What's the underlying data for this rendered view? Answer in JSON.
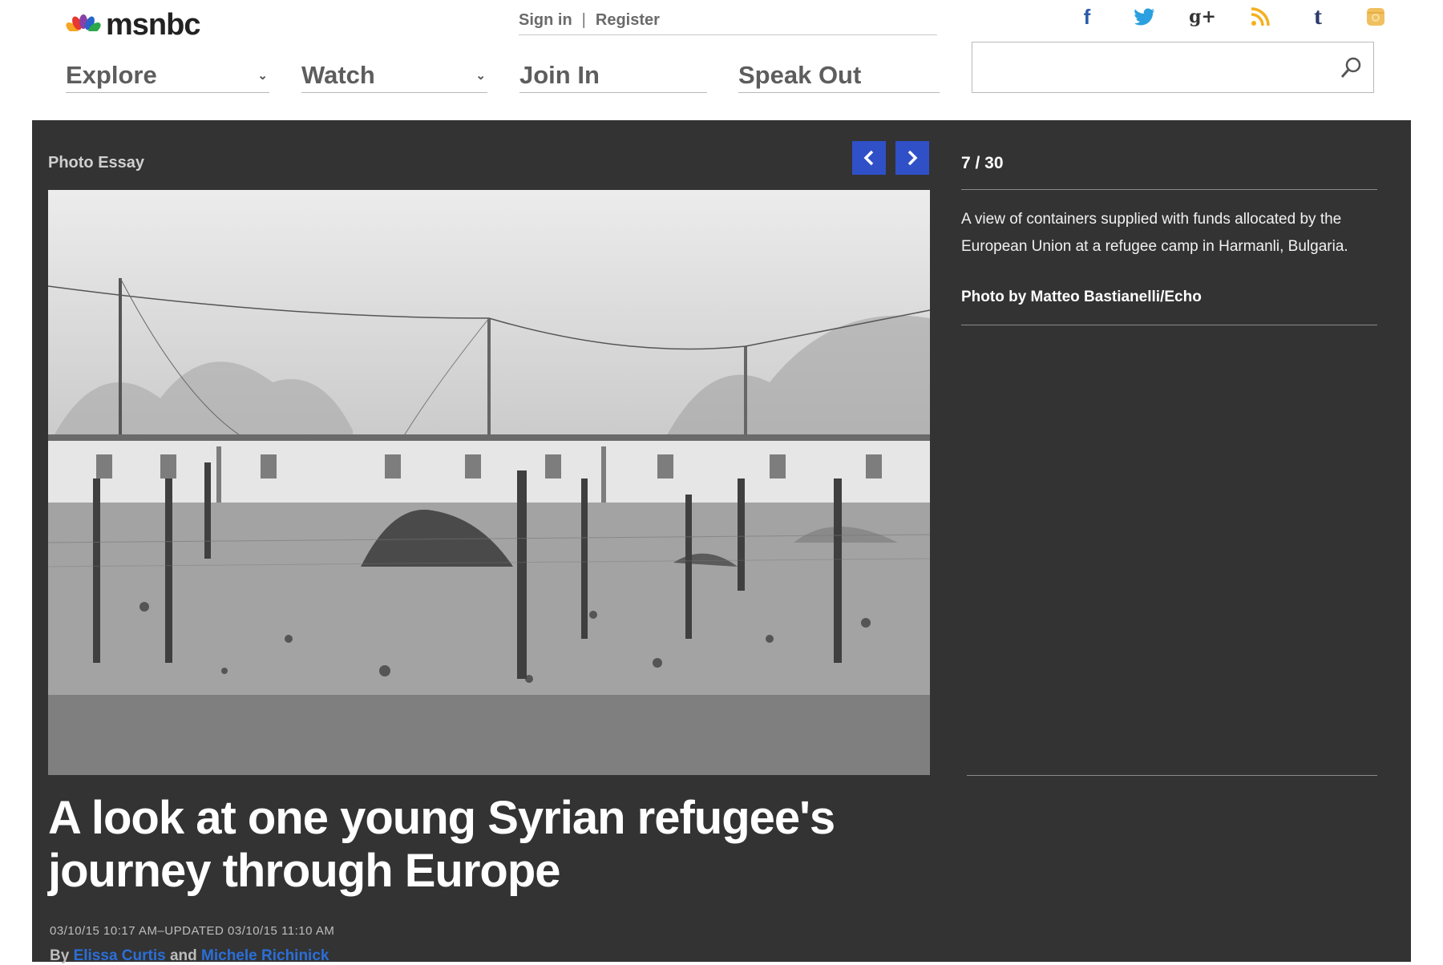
{
  "header": {
    "logo_text": "msnbc",
    "account": {
      "sign_in": "Sign in",
      "separator": "|",
      "register": "Register"
    },
    "social": [
      {
        "icon": "facebook-icon",
        "glyph": "f",
        "color": "#2a5ba8"
      },
      {
        "icon": "twitter-icon",
        "glyph": "🐦",
        "color": "#2aa0e0"
      },
      {
        "icon": "google-plus-icon",
        "glyph": "g+",
        "color": "#333333"
      },
      {
        "icon": "rss-icon",
        "glyph": "rss",
        "color": "#f5b020"
      },
      {
        "icon": "tumblr-icon",
        "glyph": "t",
        "color": "#2a3a6a"
      },
      {
        "icon": "instagram-icon",
        "glyph": "ig",
        "color": "#f0c060"
      }
    ],
    "nav": [
      {
        "label": "Explore",
        "dropdown": true
      },
      {
        "label": "Watch",
        "dropdown": true
      },
      {
        "label": "Join In",
        "dropdown": false
      },
      {
        "label": "Speak Out",
        "dropdown": false
      }
    ],
    "search": {
      "placeholder": "",
      "value": ""
    }
  },
  "gallery": {
    "section_label": "Photo Essay",
    "prev_icon": "chevron-left-icon",
    "next_icon": "chevron-right-icon",
    "accent_color": "#3050c8",
    "counter": "7 / 30",
    "current": 7,
    "total": 30,
    "caption": "A view of containers supplied with funds allocated by the European Union at a refugee camp in Harmanli, Bulgaria.",
    "credit": "Photo by Matteo Bastianelli/Echo"
  },
  "article": {
    "headline": "A look at one young Syrian refugee's journey through Europe",
    "dateline": "03/10/15 10:17 AM–UPDATED 03/10/15 11:10 AM",
    "by_label": "By",
    "authors": [
      "Elissa Curtis",
      "Michele Richinick"
    ],
    "and_label": "and",
    "link_color": "#2a6fd8"
  }
}
